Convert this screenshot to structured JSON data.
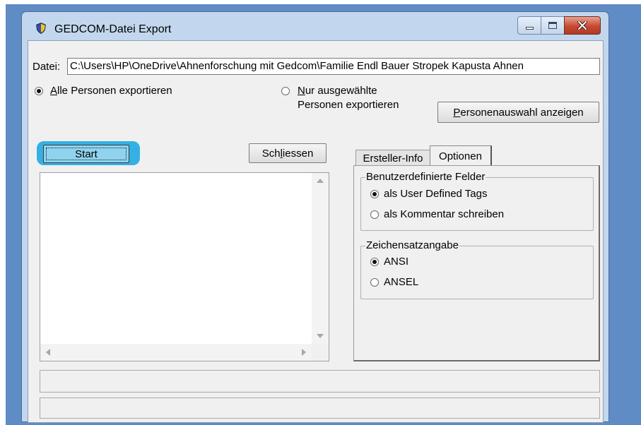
{
  "window": {
    "title": "GEDCOM-Datei Export"
  },
  "file": {
    "label": "Datei:",
    "path": "C:\\Users\\HP\\OneDrive\\Ahnenforschung mit Gedcom\\Familie Endl Bauer Stropek Kapusta Ahnen"
  },
  "export_scope": {
    "all_label_accel": "A",
    "all_label_rest": "lle Personen exportieren",
    "all_selected": true,
    "selected_label_accel": "N",
    "selected_label_line1_rest": "ur ausgewählte",
    "selected_label_line2": "Personen exportieren",
    "selected_selected": false
  },
  "buttons": {
    "show_selection_accel": "P",
    "show_selection_rest": "ersonenauswahl anzeigen",
    "start": "Start",
    "close_pre": "Sch",
    "close_accel": "l",
    "close_post": "iessen"
  },
  "tabs": [
    {
      "label": "Ersteller-Info",
      "active": false
    },
    {
      "label": "Optionen",
      "active": true
    }
  ],
  "options": {
    "custom_fields": {
      "title": "Benutzerdefinierte Felder",
      "items": [
        {
          "label": "als User Defined Tags",
          "selected": true
        },
        {
          "label": "als Kommentar schreiben",
          "selected": false
        }
      ]
    },
    "charset": {
      "title": "Zeichensatzangabe",
      "items": [
        {
          "label": "ANSI",
          "selected": true
        },
        {
          "label": "ANSEL",
          "selected": false
        }
      ]
    }
  },
  "colors": {
    "desktop": "#5f8cc4",
    "window_frame": "#c2d7ee",
    "start_highlight": "#35b0e4",
    "close_button": "#c64a33"
  }
}
